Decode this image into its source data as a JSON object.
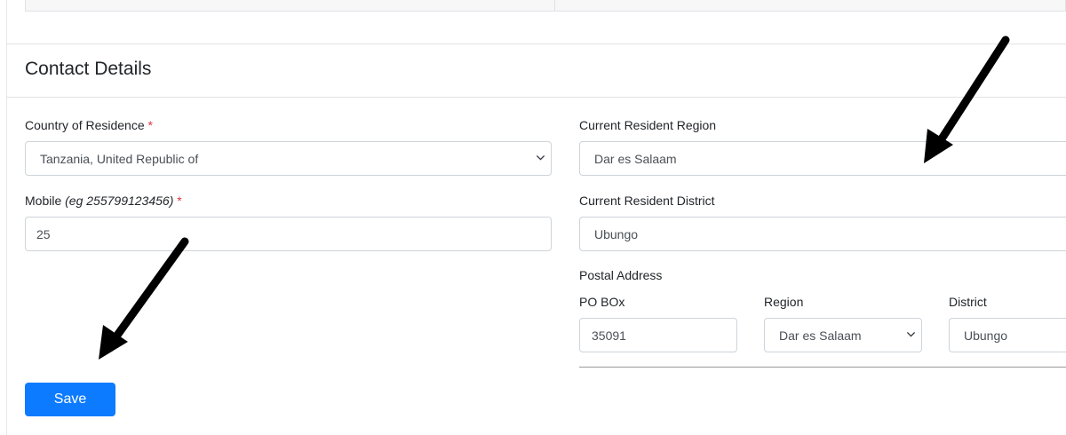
{
  "section": {
    "title": "Contact Details"
  },
  "form": {
    "country": {
      "label": "Country of Residence",
      "required_mark": "*",
      "value": "Tanzania, United Republic of"
    },
    "mobile": {
      "label": "Mobile",
      "hint": "(eg 255799123456)",
      "required_mark": "*",
      "value": "25"
    },
    "region": {
      "label": "Current Resident Region",
      "value": "Dar es Salaam"
    },
    "district": {
      "label": "Current Resident District",
      "value": "Ubungo"
    },
    "postal": {
      "heading": "Postal Address",
      "po_box": {
        "label": "PO BOx",
        "value": "35091"
      },
      "region": {
        "label": "Region",
        "value": "Dar es Salaam"
      },
      "district": {
        "label": "District",
        "value": "Ubungo"
      }
    },
    "save_label": "Save"
  },
  "colors": {
    "primary": "#0d7bff",
    "required": "#dc3545",
    "annotation_arrow": "#000000"
  }
}
